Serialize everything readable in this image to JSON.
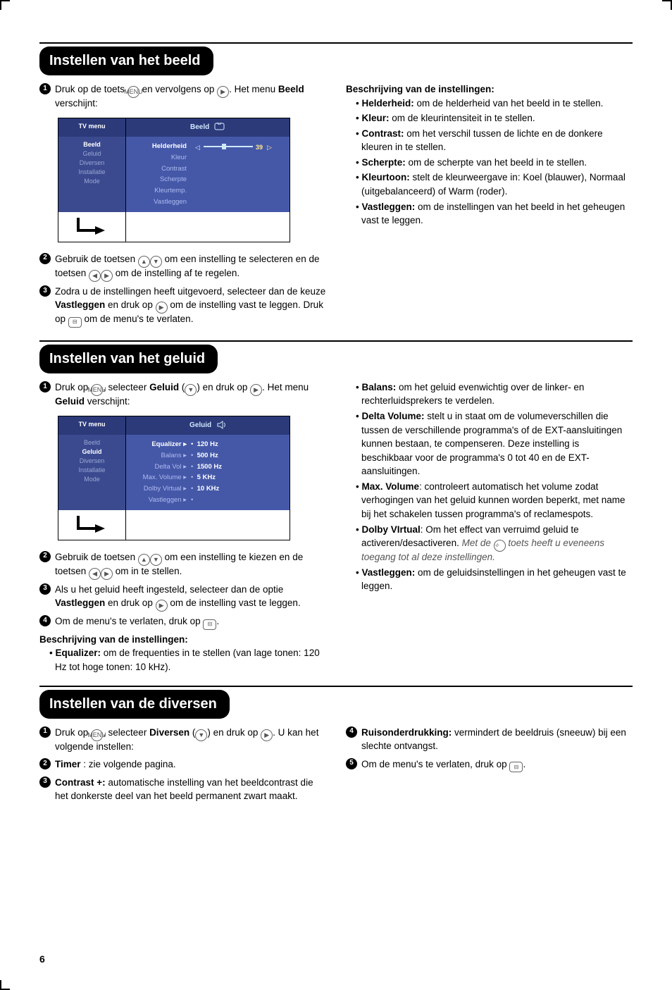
{
  "section1": {
    "title": "Instellen van het beeld",
    "leftSteps": [
      {
        "n": "1",
        "html": "Druk op de toets {MENU} en vervolgens op {RIGHT}. Het menu <b>Beeld</b> verschijnt:"
      },
      {
        "n": "2",
        "html": "Gebruik de toetsen {UP}{DOWN} om een instelling te selecteren en de toetsen {LEFT}{RIGHT} om de instelling af te regelen."
      },
      {
        "n": "3",
        "html": "Zodra u de instellingen heeft uitgevoerd, selecteer dan de keuze <b>Vastleggen</b> en druk op {RIGHT} om de instelling vast te leggen. Druk op {BOX} om de menu's te verlaten."
      }
    ],
    "menu": {
      "headerLeft": "TV menu",
      "headerRight": "Beeld",
      "leftItems": [
        "Beeld",
        "Geluid",
        "Diversen",
        "Installatie",
        "Mode"
      ],
      "rightItems": [
        "Helderheid",
        "Kleur",
        "Contrast",
        "Scherpte",
        "Kleurtemp.",
        "Vastleggen"
      ],
      "sliderValue": "39"
    },
    "descTitle": "Beschrijving van de instellingen:",
    "desc": [
      "<b>Helderheid:</b> om de helderheid van het beeld in te stellen.",
      "<b>Kleur:</b> om de kleurintensiteit in te stellen.",
      "<b>Contrast:</b> om het verschil tussen de lichte en de donkere kleuren in te stellen.",
      "<b>Scherpte:</b> om de scherpte van het beeld in te stellen.",
      "<b>Kleurtoon:</b> stelt de kleurweergave in: Koel (blauwer), Normaal (uitgebalanceerd) of Warm (roder).",
      "<b>Vastleggen:</b> om de instellingen van het beeld in het geheugen vast te leggen."
    ]
  },
  "section2": {
    "title": "Instellen van het geluid",
    "leftSteps": [
      {
        "n": "1",
        "html": "Druk op {MENU}, selecteer <b>Geluid</b> ({DOWN}) en druk op {RIGHT}. Het menu <b>Geluid</b> verschijnt:"
      },
      {
        "n": "2",
        "html": "Gebruik de toetsen {UP}{DOWN} om een instelling te kiezen en de toetsen {LEFT}{RIGHT} om in te stellen."
      },
      {
        "n": "3",
        "html": "Als u het geluid heeft ingesteld, selecteer dan de optie <b>Vastleggen</b> en druk op {RIGHT} om de instelling vast te leggen."
      },
      {
        "n": "4",
        "html": "Om de menu's te verlaten, druk op {BOX}."
      }
    ],
    "menu": {
      "headerLeft": "TV menu",
      "headerRight": "Geluid",
      "leftItems": [
        "Beeld",
        "Geluid",
        "Diversen",
        "Installatie",
        "Mode"
      ],
      "rightLabels": [
        "Equalizer",
        "Balans",
        "Delta Vol",
        "Max. Volume",
        "Dolby Virtual",
        "Vastleggen"
      ],
      "rightValues": [
        "120 Hz",
        "500 Hz",
        "1500 Hz",
        "5 KHz",
        "10 KHz",
        ""
      ]
    },
    "descTitle": "Beschrijving van de instellingen:",
    "leftDesc": [
      "<b>Equalizer:</b> om de frequenties in te stellen (van lage tonen: 120 Hz tot hoge tonen: 10 kHz)."
    ],
    "rightDesc": [
      "<b>Balans:</b> om het geluid evenwichtig over de linker- en rechterluidsprekers te verdelen.",
      "<b>Delta Volume:</b> stelt u in staat om de volumeverschillen die tussen de verschillende programma's of de EXT-aansluitingen kunnen bestaan, te compenseren. Deze instelling is beschikbaar voor de programma's 0 tot 40 en de EXT-aansluitingen.",
      "<b>Max. Volume</b>: controleert automatisch het volume zodat verhogingen van het geluid kunnen worden beperkt, met name bij het schakelen tussen programma's of reclamespots.",
      "<b>Dolby VIrtual</b>: Om het effect van verruimd geluid te activeren/desactiveren. <span class=\"italic\">Met de {SURR} toets heeft u eveneens toegang tot al deze instellingen.</span>",
      "<b>Vastleggen:</b> om de geluidsinstellingen in het geheugen vast te leggen."
    ]
  },
  "section3": {
    "title": "Instellen van de diversen",
    "leftSteps": [
      {
        "n": "1",
        "html": "Druk op {MENU}, selecteer <b>Diversen</b> ({DOWN}) en druk op {RIGHT}. U kan het volgende instellen:"
      },
      {
        "n": "2",
        "html": "<b>Timer</b> : zie volgende pagina."
      },
      {
        "n": "3",
        "html": "<b>Contrast +:</b> automatische instelling van het beeldcontrast die het donkerste deel van het beeld permanent zwart maakt."
      }
    ],
    "rightSteps": [
      {
        "n": "4",
        "html": "<b>Ruisonderdrukking:</b> vermindert de beeldruis (sneeuw) bij een slechte ontvangst."
      },
      {
        "n": "5",
        "html": "Om de menu's te verlaten, druk op {BOX}."
      }
    ]
  },
  "pageNum": "6"
}
